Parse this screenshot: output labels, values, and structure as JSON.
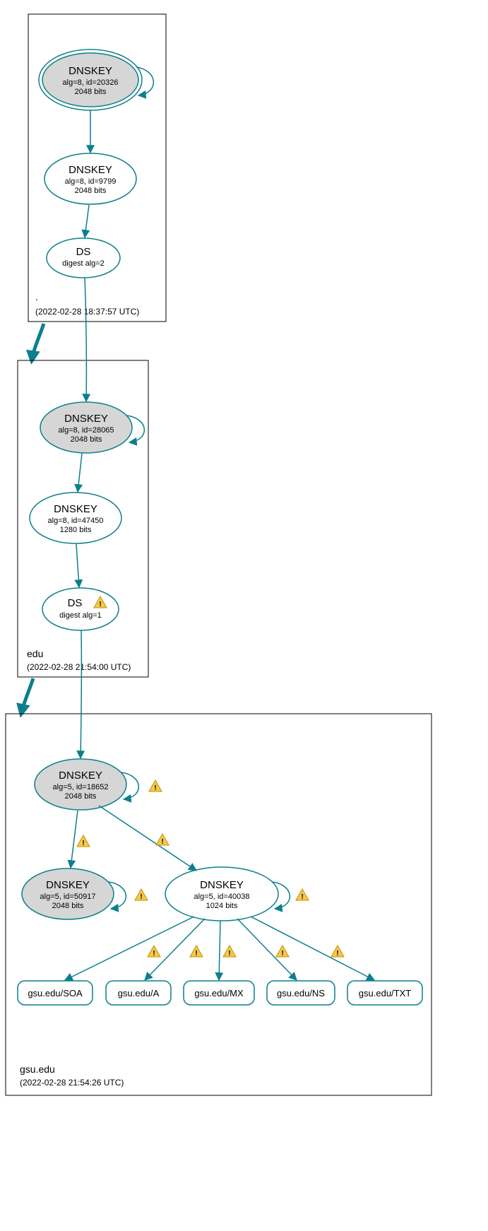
{
  "zones": {
    "root": {
      "label": ".",
      "timestamp": "(2022-02-28 18:37:57 UTC)"
    },
    "edu": {
      "label": "edu",
      "timestamp": "(2022-02-28 21:54:00 UTC)"
    },
    "gsu": {
      "label": "gsu.edu",
      "timestamp": "(2022-02-28 21:54:26 UTC)"
    }
  },
  "nodes": {
    "root_ksk": {
      "title": "DNSKEY",
      "l1": "alg=8, id=20326",
      "l2": "2048 bits"
    },
    "root_zsk": {
      "title": "DNSKEY",
      "l1": "alg=8, id=9799",
      "l2": "2048 bits"
    },
    "root_ds": {
      "title": "DS",
      "l1": "digest alg=2",
      "l2": ""
    },
    "edu_ksk": {
      "title": "DNSKEY",
      "l1": "alg=8, id=28065",
      "l2": "2048 bits"
    },
    "edu_zsk": {
      "title": "DNSKEY",
      "l1": "alg=8, id=47450",
      "l2": "1280 bits"
    },
    "edu_ds": {
      "title": "DS",
      "l1": "digest alg=1",
      "l2": ""
    },
    "gsu_ksk": {
      "title": "DNSKEY",
      "l1": "alg=5, id=18652",
      "l2": "2048 bits"
    },
    "gsu_zsk2": {
      "title": "DNSKEY",
      "l1": "alg=5, id=50917",
      "l2": "2048 bits"
    },
    "gsu_zsk": {
      "title": "DNSKEY",
      "l1": "alg=5, id=40038",
      "l2": "1024 bits"
    }
  },
  "rrsets": {
    "soa": "gsu.edu/SOA",
    "a": "gsu.edu/A",
    "mx": "gsu.edu/MX",
    "ns": "gsu.edu/NS",
    "txt": "gsu.edu/TXT"
  },
  "colors": {
    "stroke": "#0c7f8c",
    "ksk_fill": "#d6d6d6",
    "warn_fill": "#f7c948"
  }
}
